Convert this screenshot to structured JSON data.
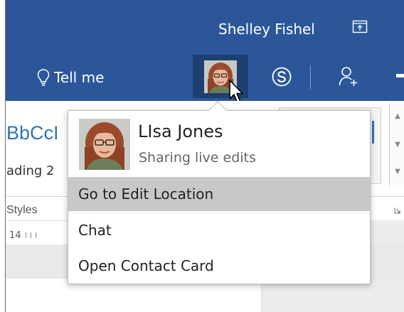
{
  "header": {
    "user_name": "Shelley Fishel",
    "tell_me": "Tell me"
  },
  "ribbon": {
    "style_sample": "BbCcI",
    "style_name": "ading 2",
    "group_label": "Styles",
    "ruler_start": "14"
  },
  "popup": {
    "contact_name": "LIsa Jones",
    "status": "Sharing live edits",
    "menu": [
      {
        "label": "Go to Edit Location",
        "highlighted": true
      },
      {
        "label": "Chat",
        "highlighted": false
      },
      {
        "label": "Open Contact Card",
        "highlighted": false
      }
    ]
  },
  "colors": {
    "ribbon_blue": "#2b579a",
    "presence_selected": "#1e3f72",
    "menu_hover": "#c8c8c8"
  },
  "icons": [
    "share-icon",
    "lightbulb-icon",
    "skype-icon",
    "add-user-icon",
    "mouse-pointer-icon",
    "dialog-launcher-icon"
  ]
}
